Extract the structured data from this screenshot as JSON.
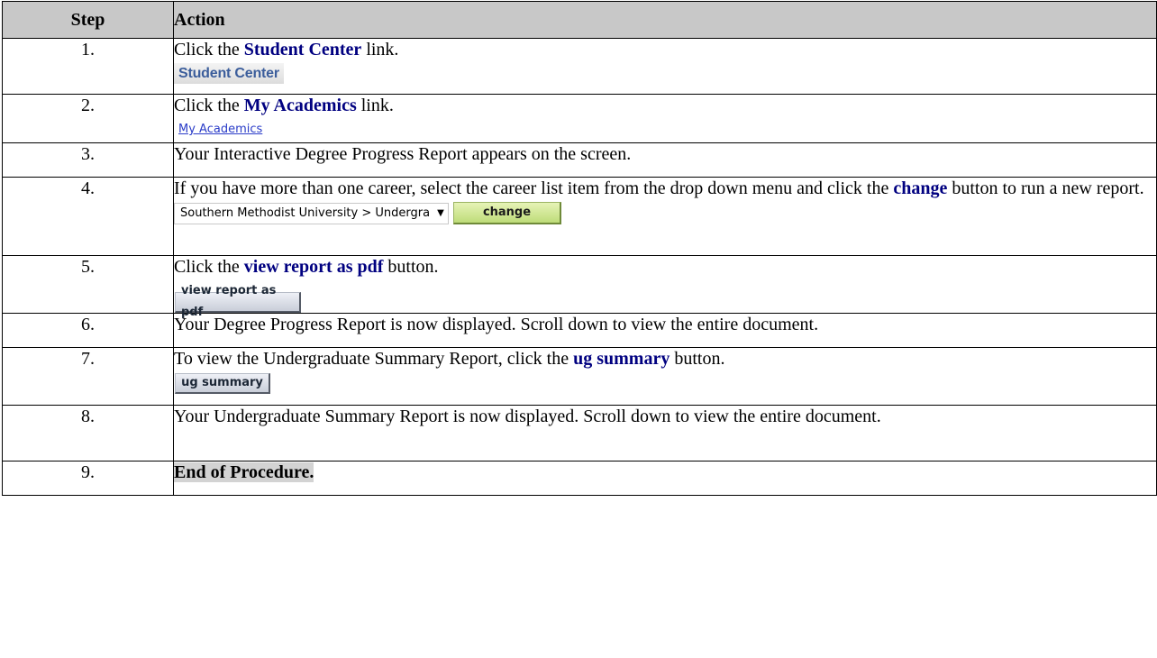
{
  "header": {
    "step": "Step",
    "action": "Action"
  },
  "steps": [
    {
      "num": "1.",
      "pre": "Click the ",
      "bold": "Student Center",
      "post": " link.",
      "snippet": "Student Center"
    },
    {
      "num": "2.",
      "pre": "Click the ",
      "bold": "My Academics",
      "post": " link.",
      "snippet": "My Academics"
    },
    {
      "num": "3.",
      "text": "Your  Interactive Degree Progress Report appears on the screen."
    },
    {
      "num": "4.",
      "pre": "If you have more than one career, select the career list item from the drop down menu and click the ",
      "bold": "change",
      "post": " button to run a new report.",
      "dropdown_value": "Southern Methodist University > Undergra",
      "button": "change"
    },
    {
      "num": "5.",
      "pre": "Click the ",
      "bold": "view report as pdf",
      "post": " button.",
      "button": "view report as pdf"
    },
    {
      "num": "6.",
      "text": "Your Degree Progress Report is now displayed. Scroll down to view the entire document."
    },
    {
      "num": "7.",
      "pre": "To view the Undergraduate Summary Report, click the ",
      "bold": "ug summary",
      "post": " button.",
      "button": "ug summary"
    },
    {
      "num": "8.",
      "text": "Your Undergraduate Summary Report is now displayed. Scroll down to view the entire document."
    },
    {
      "num": "9.",
      "highlight": "End of Procedure."
    }
  ],
  "icons": {
    "dropdown_arrow": "chevron-down-icon"
  },
  "colors": {
    "header_bg": "#c8c8c8",
    "emphasis_text": "#000080",
    "change_button": "#bedc79",
    "gray_button": "#c9ced9"
  }
}
